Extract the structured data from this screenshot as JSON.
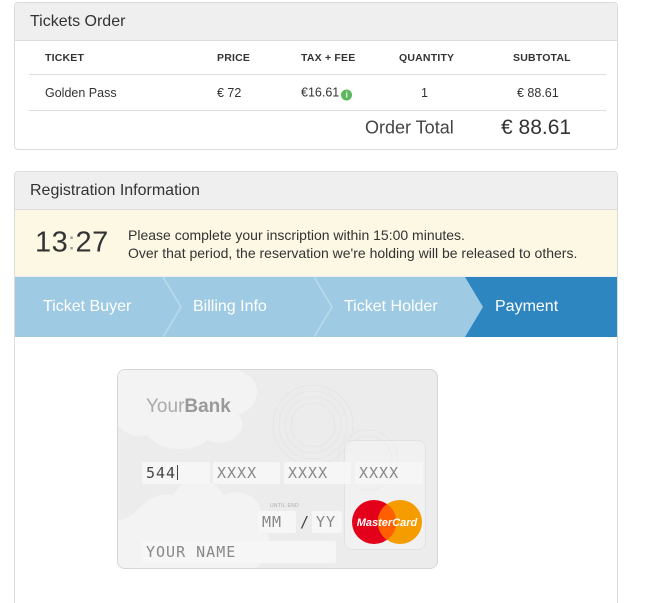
{
  "order": {
    "title": "Tickets Order",
    "columns": [
      "TICKET",
      "PRICE",
      "TAX + FEE",
      "QUANTITY",
      "SUBTOTAL"
    ],
    "rows": [
      {
        "ticket": "Golden Pass",
        "price": "€ 72",
        "tax_fee": "€16.61",
        "quantity": "1",
        "subtotal": "€ 88.61"
      }
    ],
    "total_label": "Order Total",
    "total_value": "€ 88.61",
    "info_icon": "info-circle-icon",
    "info_color": "#5cb85c"
  },
  "registration": {
    "title": "Registration Information",
    "timer_minutes": "13",
    "timer_seconds": "27",
    "notice_line1": "Please complete your inscription within 15:00 minutes.",
    "notice_line2": "Over that period, the reservation we're holding will be released to others.",
    "notice_bg": "#fcf8e3",
    "steps": [
      {
        "label": "Ticket Buyer",
        "active": false
      },
      {
        "label": "Billing Info",
        "active": false
      },
      {
        "label": "Ticket Holder",
        "active": false
      },
      {
        "label": "Payment",
        "active": true
      }
    ],
    "step_color": "#9ecbe3",
    "step_active_color": "#2e86c1"
  },
  "card": {
    "bank_prefix": "Your",
    "bank_suffix": "Bank",
    "number_group1": "544",
    "number_group2_placeholder": "XXXX",
    "number_group3_placeholder": "XXXX",
    "number_group4_placeholder": "XXXX",
    "valid_end_label": "UNTIL END",
    "month_placeholder": "MM",
    "year_placeholder": "YY",
    "date_separator": "/",
    "name_placeholder": "YOUR NAME",
    "brand": "MasterCard",
    "brand_logo": "mastercard-logo"
  }
}
